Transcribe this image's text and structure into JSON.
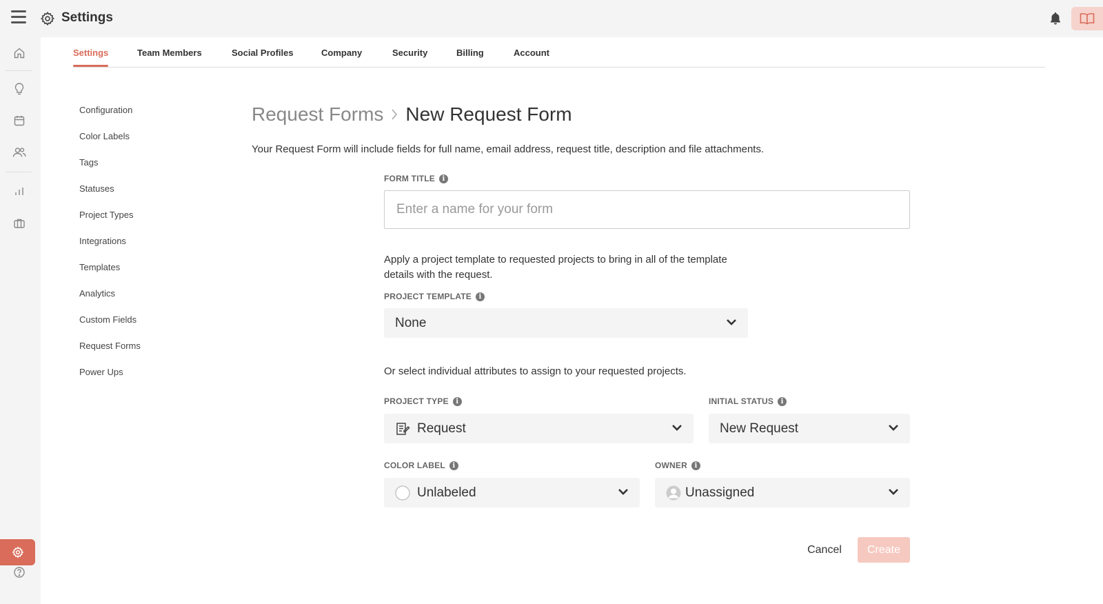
{
  "app": {
    "title": "Settings"
  },
  "tabs": [
    {
      "label": "Settings"
    },
    {
      "label": "Team Members"
    },
    {
      "label": "Social Profiles"
    },
    {
      "label": "Company"
    },
    {
      "label": "Security"
    },
    {
      "label": "Billing"
    },
    {
      "label": "Account"
    }
  ],
  "subnav": [
    {
      "label": "Configuration"
    },
    {
      "label": "Color Labels"
    },
    {
      "label": "Tags"
    },
    {
      "label": "Statuses"
    },
    {
      "label": "Project Types"
    },
    {
      "label": "Integrations"
    },
    {
      "label": "Templates"
    },
    {
      "label": "Analytics"
    },
    {
      "label": "Custom Fields"
    },
    {
      "label": "Request Forms"
    },
    {
      "label": "Power Ups"
    }
  ],
  "breadcrumb": {
    "parent": "Request Forms",
    "current": "New Request Form"
  },
  "form": {
    "intro": "Your Request Form will include fields for full name, email address, request title, description and file attachments.",
    "title_label": "FORM TITLE",
    "title_placeholder": "Enter a name for your form",
    "template_help": "Apply a project template to requested projects to bring in all of the template details with the request.",
    "template_label": "PROJECT TEMPLATE",
    "template_value": "None",
    "attributes_help": "Or select individual attributes to assign to your requested projects.",
    "project_type_label": "PROJECT TYPE",
    "project_type_value": "Request",
    "initial_status_label": "INITIAL STATUS",
    "initial_status_value": "New Request",
    "color_label_label": "COLOR LABEL",
    "color_label_value": "Unlabeled",
    "owner_label": "OWNER",
    "owner_value": "Unassigned",
    "info_glyph": "i"
  },
  "actions": {
    "cancel": "Cancel",
    "create": "Create"
  },
  "colors": {
    "accent": "#d96c5a",
    "accent_light": "#f6c9c0",
    "field_bg": "#f4f4f4"
  }
}
